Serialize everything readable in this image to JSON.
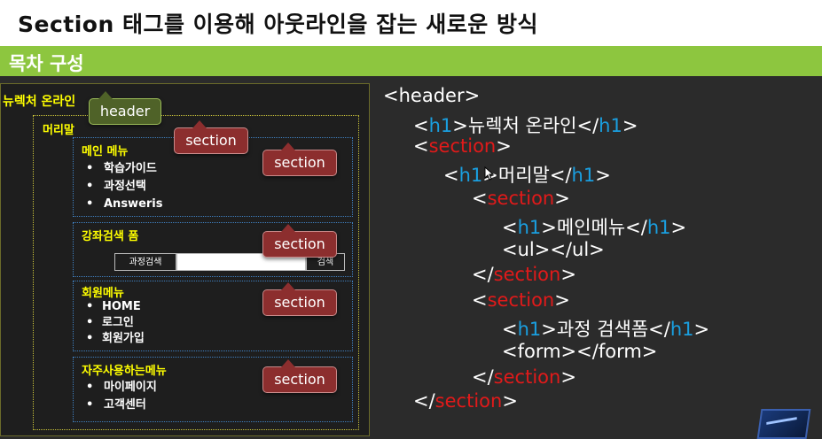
{
  "title": "Section 태그를 이용해 아웃라인을 잡는 새로운 방식",
  "subtitle": "목차 구성",
  "diagram": {
    "site_title": "뉴렉처 온라인",
    "header_label": "머리말",
    "menu": {
      "title": "메인 메뉴",
      "items": [
        "학습가이드",
        "과정선택",
        "Answeris"
      ]
    },
    "search": {
      "title": "강좌검색 폼",
      "label": "과정검색",
      "button": "검색"
    },
    "member": {
      "title": "회원메뉴",
      "items": [
        "HOME",
        "로그인",
        "회원가입"
      ]
    },
    "frequent": {
      "title": "자주사용하는메뉴",
      "items": [
        "마이페이지",
        "고객센터"
      ]
    },
    "callouts": {
      "header": "header",
      "section": "section"
    }
  },
  "code": {
    "header_open": "<header>",
    "h1_open": "<h1>",
    "h1_close": "</h1>",
    "site_title": "뉴렉처 온라인",
    "section_open": "<section>",
    "section_close": "</section>",
    "header_text": "머리말",
    "menu_text": "메인메뉴",
    "ul_text": "<ul></ul>",
    "search_text": "과정 검색폼",
    "form_text": "<form></form>"
  },
  "colors": {
    "title_bg": "#ffffff",
    "green": "#8dc63f",
    "red_tag": "#8c2e2e",
    "green_tag": "#4f6228",
    "code_red": "#e11a1a",
    "code_blue": "#1a9fe0",
    "label_yellow": "#ffff00"
  },
  "icons": [
    "mouse-cursor-icon",
    "slide-logo-icon"
  ]
}
